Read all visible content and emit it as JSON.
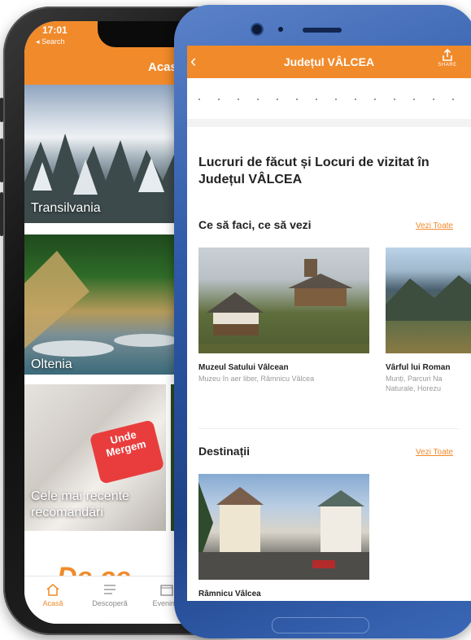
{
  "back_phone": {
    "status_time": "17:01",
    "status_back": "◂ Search",
    "header_title": "Acas",
    "tiles": [
      {
        "label": "Transilvania"
      },
      {
        "label": "Oltenia"
      },
      {
        "label": "Cele mai recente recomandări"
      }
    ],
    "promo_text": "De ce",
    "logo_text": "Unde Mergem",
    "tabs": [
      {
        "label": "Acasă",
        "icon": "home-icon"
      },
      {
        "label": "Descoperă",
        "icon": "list-icon"
      },
      {
        "label": "Evenime",
        "icon": "calendar-icon"
      }
    ]
  },
  "front_phone": {
    "header": {
      "title": "Județul VÂLCEA",
      "share_label": "SHARE"
    },
    "heading": "Lucruri de făcut și Locuri de vizitat în Județul VÂLCEA",
    "sections": {
      "things": {
        "title": "Ce să faci, ce să vezi",
        "see_all": "Vezi Toate",
        "cards": [
          {
            "name": "Muzeul Satului Vâlcean",
            "subtitle": "Muzeu în aer liber, Râmnicu Vâlcea"
          },
          {
            "name": "Vârful lui Roman",
            "subtitle": "Munți, Parcuri Na Naturale, Horezu"
          }
        ]
      },
      "destinations": {
        "title": "Destinații",
        "see_all": "Vezi Toate",
        "cards": [
          {
            "name": "Râmnicu Vâlcea"
          }
        ]
      }
    }
  },
  "colors": {
    "accent": "#f18a2a",
    "phone_blue": "#2e5aa8"
  }
}
